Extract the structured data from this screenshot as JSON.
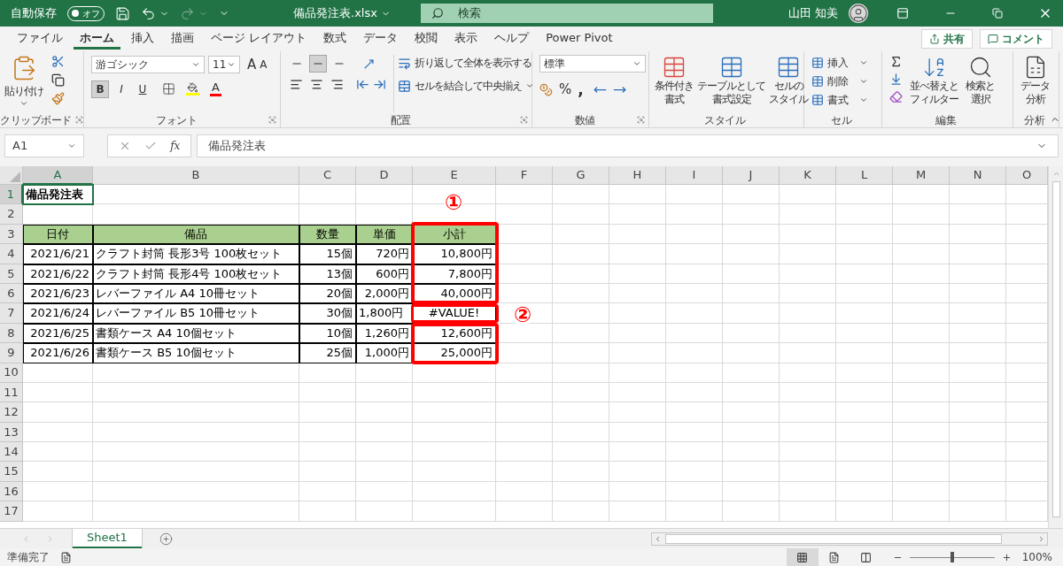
{
  "title_bar": {
    "autosave_label": "自動保存",
    "autosave_toggle": {
      "label": "オフ",
      "on": false
    },
    "file_name": "備品発注表.xlsx",
    "search_placeholder": "検索",
    "user_name": "山田 知美"
  },
  "menu_tabs": [
    {
      "label": "ファイル",
      "selected": false
    },
    {
      "label": "ホーム",
      "selected": true
    },
    {
      "label": "挿入",
      "selected": false
    },
    {
      "label": "描画",
      "selected": false
    },
    {
      "label": "ページ レイアウト",
      "selected": false
    },
    {
      "label": "数式",
      "selected": false
    },
    {
      "label": "データ",
      "selected": false
    },
    {
      "label": "校閲",
      "selected": false
    },
    {
      "label": "表示",
      "selected": false
    },
    {
      "label": "ヘルプ",
      "selected": false
    },
    {
      "label": "Power Pivot",
      "selected": false
    }
  ],
  "share_button": "共有",
  "comment_button": "コメント",
  "ribbon": {
    "clipboard": {
      "paste": "貼り付け",
      "group_label": "クリップボード"
    },
    "font": {
      "font_name": "游ゴシック",
      "font_size": "11",
      "grow": "A",
      "shrink": "A",
      "styles": [
        {
          "label": "B",
          "selected": true
        },
        {
          "label": "I",
          "selected": false
        },
        {
          "label": "U",
          "selected": false
        }
      ],
      "font_color": "A",
      "group_label": "フォント"
    },
    "alignment": {
      "vertical": [
        {
          "selected": false
        },
        {
          "selected": true
        },
        {
          "selected": false
        }
      ],
      "wrap_text": "折り返して全体を表示する",
      "merge_center": "セルを結合して中央揃え",
      "group_label": "配置"
    },
    "number": {
      "format": "標準",
      "percent": "%",
      "comma": ",",
      "group_label": "数値"
    },
    "styles": {
      "buttons": [
        {
          "lines": [
            "条件付き",
            "書式"
          ]
        },
        {
          "lines": [
            "テーブルとして",
            "書式設定"
          ]
        },
        {
          "lines": [
            "セルの",
            "スタイル"
          ]
        }
      ],
      "group_label": "スタイル"
    },
    "cells": {
      "buttons": [
        "挿入",
        "削除",
        "書式"
      ],
      "group_label": "セル"
    },
    "editing": {
      "buttons": [
        {
          "lines": [
            "並べ替えと",
            "フィルター"
          ]
        },
        {
          "lines": [
            "検索と",
            "選択"
          ]
        }
      ],
      "group_label": "編集"
    },
    "analysis": {
      "buttons": [
        {
          "lines": [
            "データ",
            "分析"
          ]
        }
      ],
      "group_label": "分析"
    }
  },
  "formula_bar": {
    "name_box": "A1",
    "function_label": "fx",
    "formula": "備品発注表"
  },
  "sheet": {
    "columns": [
      {
        "label": "A",
        "selected": true
      },
      {
        "label": "B",
        "selected": false
      },
      {
        "label": "C",
        "selected": false
      },
      {
        "label": "D",
        "selected": false
      },
      {
        "label": "E",
        "selected": false
      },
      {
        "label": "F",
        "selected": false
      },
      {
        "label": "G",
        "selected": false
      },
      {
        "label": "H",
        "selected": false
      },
      {
        "label": "I",
        "selected": false
      },
      {
        "label": "J",
        "selected": false
      },
      {
        "label": "K",
        "selected": false
      },
      {
        "label": "L",
        "selected": false
      },
      {
        "label": "M",
        "selected": false
      },
      {
        "label": "N",
        "selected": false
      },
      {
        "label": "O",
        "selected": false
      }
    ],
    "rows": [
      {
        "number": "1",
        "selected": true,
        "cells": [
          {
            "text": "備品発注表",
            "kind": "title",
            "selected": true
          }
        ]
      },
      {
        "number": "2",
        "selected": false
      },
      {
        "number": "3",
        "selected": false,
        "cells": [
          {
            "text": "日付",
            "kind": "header"
          },
          {
            "text": "備品",
            "kind": "header"
          },
          {
            "text": "数量",
            "kind": "header"
          },
          {
            "text": "単価",
            "kind": "header"
          },
          {
            "text": "小計",
            "kind": "header"
          }
        ]
      },
      {
        "number": "4",
        "selected": false,
        "cells": [
          {
            "text": "2021/6/21",
            "kind": "number"
          },
          {
            "text": "クラフト封筒 長形3号 100枚セット",
            "kind": "text"
          },
          {
            "text": "15個",
            "kind": "number"
          },
          {
            "text": "720円",
            "kind": "number"
          },
          {
            "text": "10,800円",
            "kind": "number"
          }
        ]
      },
      {
        "number": "5",
        "selected": false,
        "cells": [
          {
            "text": "2021/6/22",
            "kind": "number"
          },
          {
            "text": "クラフト封筒 長形4号 100枚セット",
            "kind": "text"
          },
          {
            "text": "13個",
            "kind": "number"
          },
          {
            "text": "600円",
            "kind": "number"
          },
          {
            "text": "7,800円",
            "kind": "number"
          }
        ]
      },
      {
        "number": "6",
        "selected": false,
        "cells": [
          {
            "text": "2021/6/23",
            "kind": "number"
          },
          {
            "text": "レバーファイル A4 10冊セット",
            "kind": "text"
          },
          {
            "text": "20個",
            "kind": "number"
          },
          {
            "text": "2,000円",
            "kind": "number"
          },
          {
            "text": "40,000円",
            "kind": "number"
          }
        ]
      },
      {
        "number": "7",
        "selected": false,
        "cells": [
          {
            "text": "2021/6/24",
            "kind": "number"
          },
          {
            "text": "レバーファイル B5 10冊セット",
            "kind": "text"
          },
          {
            "text": "30個",
            "kind": "number"
          },
          {
            "text": "1,800円",
            "kind": "text"
          },
          {
            "text": "#VALUE!",
            "kind": "error"
          }
        ]
      },
      {
        "number": "8",
        "selected": false,
        "cells": [
          {
            "text": "2021/6/25",
            "kind": "number"
          },
          {
            "text": "書類ケース A4 10個セット",
            "kind": "text"
          },
          {
            "text": "10個",
            "kind": "number"
          },
          {
            "text": "1,260円",
            "kind": "number"
          },
          {
            "text": "12,600円",
            "kind": "number"
          }
        ]
      },
      {
        "number": "9",
        "selected": false,
        "cells": [
          {
            "text": "2021/6/26",
            "kind": "number"
          },
          {
            "text": "書類ケース B5 10個セット",
            "kind": "text"
          },
          {
            "text": "25個",
            "kind": "number"
          },
          {
            "text": "1,000円",
            "kind": "number"
          },
          {
            "text": "25,000円",
            "kind": "number"
          }
        ]
      },
      {
        "number": "10",
        "selected": false
      },
      {
        "number": "11",
        "selected": false
      },
      {
        "number": "12",
        "selected": false
      },
      {
        "number": "13",
        "selected": false
      },
      {
        "number": "14",
        "selected": false
      },
      {
        "number": "15",
        "selected": false
      },
      {
        "number": "16",
        "selected": false
      },
      {
        "number": "17",
        "selected": false
      }
    ],
    "callouts": [
      {
        "label": "①"
      },
      {
        "label": "②"
      }
    ]
  },
  "sheet_tabs": [
    {
      "label": "Sheet1",
      "selected": true
    }
  ],
  "status_bar": {
    "status": "準備完了",
    "views": [
      {
        "selected": true
      },
      {
        "selected": false
      },
      {
        "selected": false
      }
    ],
    "zoom_slider": {
      "level": 0.5
    },
    "zoom": "100%"
  }
}
